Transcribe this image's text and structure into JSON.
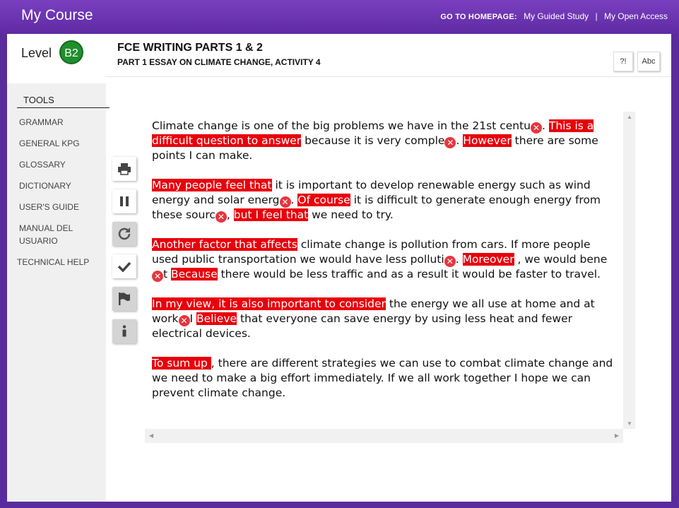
{
  "app": {
    "title": "My Course"
  },
  "topnav": {
    "go_label": "GO TO HOMEPAGE:",
    "guided": "My Guided Study",
    "sep": "|",
    "open": "My Open Access"
  },
  "level": {
    "label": "Level",
    "badge": "B2"
  },
  "header": {
    "title": "FCE WRITING PARTS 1 & 2",
    "subtitle": "PART 1 ESSAY ON CLIMATE CHANGE, ACTIVITY 4",
    "help_btn": "?!",
    "abc_btn": "Abc"
  },
  "sidebar": {
    "heading": "TOOLS",
    "items": [
      "GRAMMAR",
      "GENERAL KPG",
      "GLOSSARY",
      "DICTIONARY",
      "USER'S GUIDE",
      "MANUAL DEL USUARIO",
      "TECHNICAL HELP"
    ]
  },
  "toolbar": {
    "icons": [
      "print-icon",
      "pause-icon",
      "redo-icon",
      "check-icon",
      "flag-icon",
      "info-icon"
    ]
  },
  "essay": {
    "error_mark": "✕",
    "paragraphs": [
      [
        {
          "t": "Climate change is one of the big problems we have in the 21st centu"
        },
        {
          "x": true
        },
        {
          "t": ". "
        },
        {
          "t": "This is a difficult question to answer",
          "h": true
        },
        {
          "t": " because it is very comple"
        },
        {
          "x": true
        },
        {
          "t": ". "
        },
        {
          "t": "However",
          "h": true
        },
        {
          "t": " there are some points I can make."
        }
      ],
      [
        {
          "t": "Many people feel that",
          "h": true
        },
        {
          "t": " it is important to develop renewable energy such as wind energy and solar energ"
        },
        {
          "x": true
        },
        {
          "t": ". "
        },
        {
          "t": "Of course",
          "h": true
        },
        {
          "t": " it is difficult to generate enough energy from these sourc"
        },
        {
          "x": true
        },
        {
          "t": ", "
        },
        {
          "t": "but I feel that",
          "h": true
        },
        {
          "t": " we need to try."
        }
      ],
      [
        {
          "t": "Another factor that affects",
          "h": true
        },
        {
          "t": " climate change is pollution from cars. If more people used public transportation we would have less polluti"
        },
        {
          "x": true
        },
        {
          "t": ". "
        },
        {
          "t": "Moreover",
          "h": true
        },
        {
          "t": " , we would bene"
        },
        {
          "x": true
        },
        {
          "t": "t "
        },
        {
          "t": "Because",
          "h": true
        },
        {
          "t": " there would be less traffic and as a result it would be faster to travel."
        }
      ],
      [
        {
          "t": "In my view, it is also important to consider",
          "h": true
        },
        {
          "t": " the energy we all use at home and at work"
        },
        {
          "x": true
        },
        {
          "t": "I "
        },
        {
          "t": "Believe",
          "h": true
        },
        {
          "t": " that everyone can save energy by using less heat and fewer electrical devices."
        }
      ],
      [
        {
          "t": "To sum up ",
          "h": true
        },
        {
          "t": " , there are different strategies we can use to combat climate change and we need to make a big effort immediately. If we all work together I hope we can prevent climate change."
        }
      ]
    ]
  },
  "colors": {
    "brand": "#5e2ba2",
    "highlight": "#e8000b",
    "level_badge": "#1f8f2d"
  }
}
